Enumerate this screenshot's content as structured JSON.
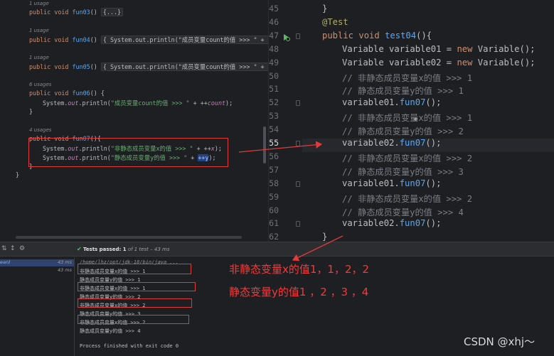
{
  "left_editor": {
    "blocks": [
      {
        "usage": "1 usage",
        "code_kw": "public void ",
        "code_fn": "fun03",
        "code_rest": "() ",
        "fold": "{...}"
      },
      {
        "usage": "1 usage",
        "code_kw": "public void ",
        "code_fn": "fun04",
        "code_rest": "() ",
        "fold": "{ System.out.println(\"成员变量count的值 >>> \" + cou"
      },
      {
        "usage": "1 usage",
        "code_kw": "public void ",
        "code_fn": "fun05",
        "code_rest": "() ",
        "fold": "{ System.out.println(\"成员变量count的值 >>> \" + cou"
      }
    ],
    "fun06": {
      "usage": "6 usages",
      "sig_kw": "public void ",
      "sig_fn": "fun06",
      "sig_rest": "() {",
      "body_a": "System.",
      "body_out": "out",
      "body_b": ".println(",
      "body_str": "\"成员变量count的值 >>> \"",
      "body_c": " + ++",
      "body_fld": "count",
      "body_d": ");",
      "close": "}"
    },
    "fun07": {
      "usage": "4 usages",
      "sig_kw": "public void ",
      "sig_fn": "fun07",
      "sig_rest": "(){",
      "l1_a": "System.",
      "l1_out": "out",
      "l1_b": ".println(",
      "l1_str": "\"非静态成员变量x的值 >>> \"",
      "l1_c": " + ++",
      "l1_fld": "x",
      "l1_d": ");",
      "l2_a": "System.",
      "l2_out": "out",
      "l2_b": ".println(",
      "l2_str": "\"静态成员变量y的值 >>> \"",
      "l2_c": " + ",
      "l2_hl": "++y",
      "l2_d": ");",
      "close": "}"
    },
    "class_close": "}"
  },
  "right_editor": {
    "lines": [
      {
        "n": "45",
        "code": "}"
      },
      {
        "n": "46",
        "code": "@Test"
      },
      {
        "n": "47",
        "code": "public void test04(){"
      },
      {
        "n": "48",
        "code": "Variable variable01 = new Variable();"
      },
      {
        "n": "49",
        "code": "Variable variable02 = new Variable();"
      },
      {
        "n": "50",
        "code": "// 非静态成员变量x的值 >>> 1"
      },
      {
        "n": "51",
        "code": "// 静态成员变量y的值 >>> 1"
      },
      {
        "n": "52",
        "code": "variable01.fun07();"
      },
      {
        "n": "53",
        "code": "// 非静态成员变量x的值 >>> 1"
      },
      {
        "n": "54",
        "code": "// 静态成员变量y的值 >>> 2"
      },
      {
        "n": "55",
        "code": "variable02.fun07();"
      },
      {
        "n": "56",
        "code": "// 非静态成员变量x的值 >>> 2"
      },
      {
        "n": "57",
        "code": "// 静态成员变量y的值 >>> 3"
      },
      {
        "n": "58",
        "code": "variable01.fun07();"
      },
      {
        "n": "59",
        "code": "// 非静态成员变量x的值 >>> 2"
      },
      {
        "n": "60",
        "code": "// 静态成员变量y的值 >>> 4"
      },
      {
        "n": "61",
        "code": "variable02.fun07();"
      },
      {
        "n": "62",
        "code": "}"
      }
    ]
  },
  "run_panel": {
    "status_prefix": "Tests passed: ",
    "status_count": "1",
    "status_suffix": " of 1 test – 43 ms",
    "tree": [
      {
        "name": "ean)",
        "time": "43 ms"
      },
      {
        "name": "",
        "time": "43 ms"
      }
    ],
    "output": [
      "/home/lhz/opt/jdk-18/bin/java ...",
      "非静态成员变量x的值 >>> 1",
      "静态成员变量y的值 >>> 1",
      "非静态成员变量x的值 >>> 1",
      "静态成员变量y的值 >>> 2",
      "非静态成员变量x的值 >>> 2",
      "静态成员变量y的值 >>> 3",
      "非静态成员变量x的值 >>> 2",
      "静态成员变量y的值 >>> 4",
      "Process finished with exit code 0"
    ]
  },
  "annotations": {
    "note_x": "非静态变量x的值1，1，2，2",
    "note_y": "静态变量y的值1 ，2 ，3 ，4",
    "watermark": "CSDN @xhj～",
    "color": "#e03a3a"
  }
}
